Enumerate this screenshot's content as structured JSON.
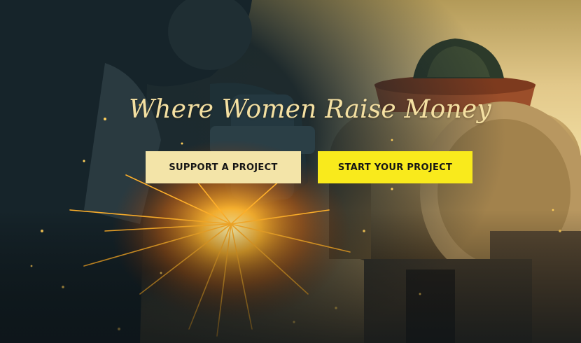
{
  "hero": {
    "title": "Where Women Raise Money",
    "background_image": "workshop-angle-grinder-sparks-photo"
  },
  "cta": {
    "support_label": "SUPPORT A PROJECT",
    "start_label": "START YOUR PROJECT"
  },
  "colors": {
    "title_text": "#f4e0a2",
    "support_button_bg": "#f3e4a8",
    "start_button_bg": "#f9ea1c",
    "button_text": "#151515"
  }
}
